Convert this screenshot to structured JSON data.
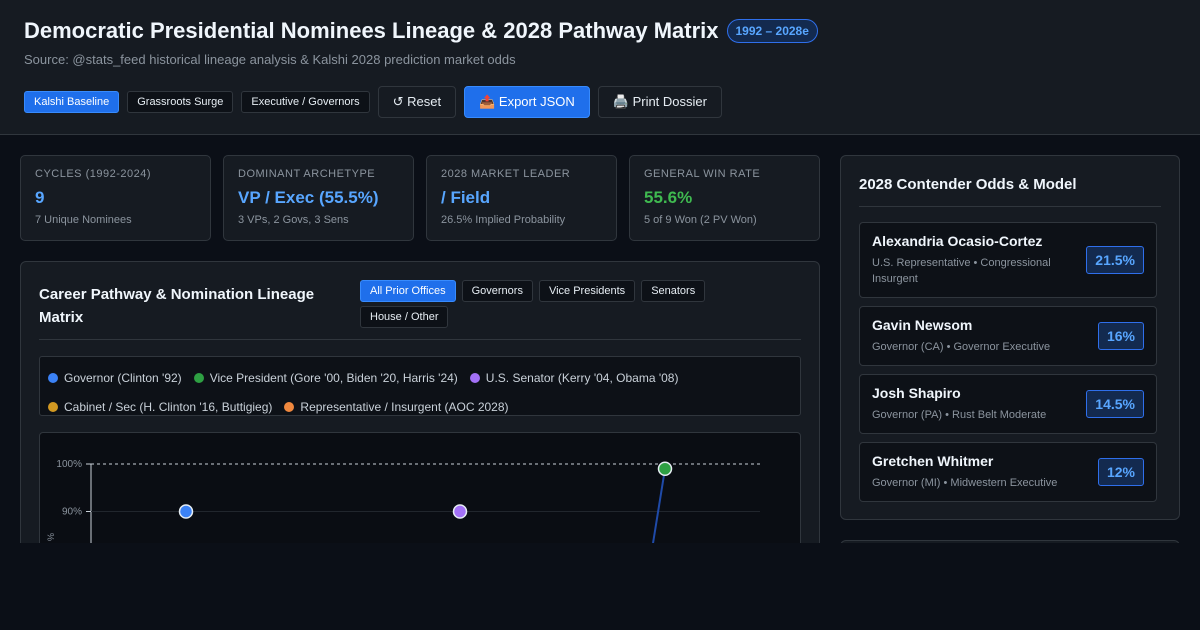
{
  "header": {
    "title": "Democratic Presidential Nominees Lineage & 2028 Pathway Matrix",
    "badge": "1992 – 2028e",
    "source": "Source: @stats_feed historical lineage analysis & Kalshi 2028 prediction market odds"
  },
  "toolbar": {
    "scenarios": [
      {
        "label": "Kalshi Baseline",
        "active": true
      },
      {
        "label": "Grassroots Surge",
        "active": false
      },
      {
        "label": "Executive / Governors",
        "active": false
      }
    ],
    "reset_label": "↺ Reset",
    "export_label": "📤 Export JSON",
    "print_label": "🖨️ Print Dossier"
  },
  "stats": [
    {
      "label": "CYCLES (1992-2024)",
      "value": "9",
      "sub": "7 Unique Nominees",
      "color": "blue"
    },
    {
      "label": "DOMINANT ARCHETYPE",
      "value": "VP / Exec (55.5%)",
      "sub": "3 VPs, 2 Govs, 3 Sens",
      "color": "blue"
    },
    {
      "label": "2028 MARKET LEADER",
      "value": "/ Field",
      "sub": "26.5% Implied Probability",
      "color": "blue"
    },
    {
      "label": "GENERAL WIN RATE",
      "value": "55.6%",
      "sub": "5 of 9 Won (2 PV Won)",
      "color": "green"
    }
  ],
  "lineage": {
    "title": "Career Pathway & Nomination Lineage Matrix",
    "filters": [
      {
        "label": "All Prior Offices",
        "active": true
      },
      {
        "label": "Governors",
        "active": false
      },
      {
        "label": "Vice Presidents",
        "active": false
      },
      {
        "label": "Senators",
        "active": false
      },
      {
        "label": "House / Other",
        "active": false
      }
    ],
    "legend": [
      {
        "label": "Governor (Clinton '92)",
        "color": "#3b82f6"
      },
      {
        "label": "Vice President (Gore '00, Biden '20, Harris '24)",
        "color": "#2ea043"
      },
      {
        "label": "U.S. Senator (Kerry '04, Obama '08)",
        "color": "#a371f7"
      },
      {
        "label": "Cabinet / Sec (H. Clinton '16, Buttigieg)",
        "color": "#d29922"
      },
      {
        "label": "Representative / Insurgent (AOC 2028)",
        "color": "#f0883e"
      }
    ]
  },
  "chart_data": {
    "type": "line",
    "y_tick_labels": [
      "100%",
      "90%"
    ],
    "ylim": [
      80,
      100
    ],
    "reference_line": 100,
    "points": [
      {
        "x": 1,
        "y": 90,
        "color": "#3b82f6"
      },
      {
        "x": 2,
        "y": 90,
        "color": "#a371f7"
      },
      {
        "x": 3,
        "y": 99,
        "color": "#2ea043"
      }
    ],
    "ylabel": "%"
  },
  "sidebar": {
    "title": "2028 Contender Odds & Model",
    "candidates": [
      {
        "name": "Alexandria Ocasio-Cortez",
        "desc": "U.S. Representative • Congressional Insurgent",
        "odds": "21.5%"
      },
      {
        "name": "Gavin Newsom",
        "desc": "Governor (CA) • Governor Executive",
        "odds": "16%"
      },
      {
        "name": "Josh Shapiro",
        "desc": "Governor (PA) • Rust Belt Moderate",
        "odds": "14.5%"
      },
      {
        "name": "Gretchen Whitmer",
        "desc": "Governor (MI) • Midwestern Executive",
        "odds": "12%"
      }
    ]
  }
}
